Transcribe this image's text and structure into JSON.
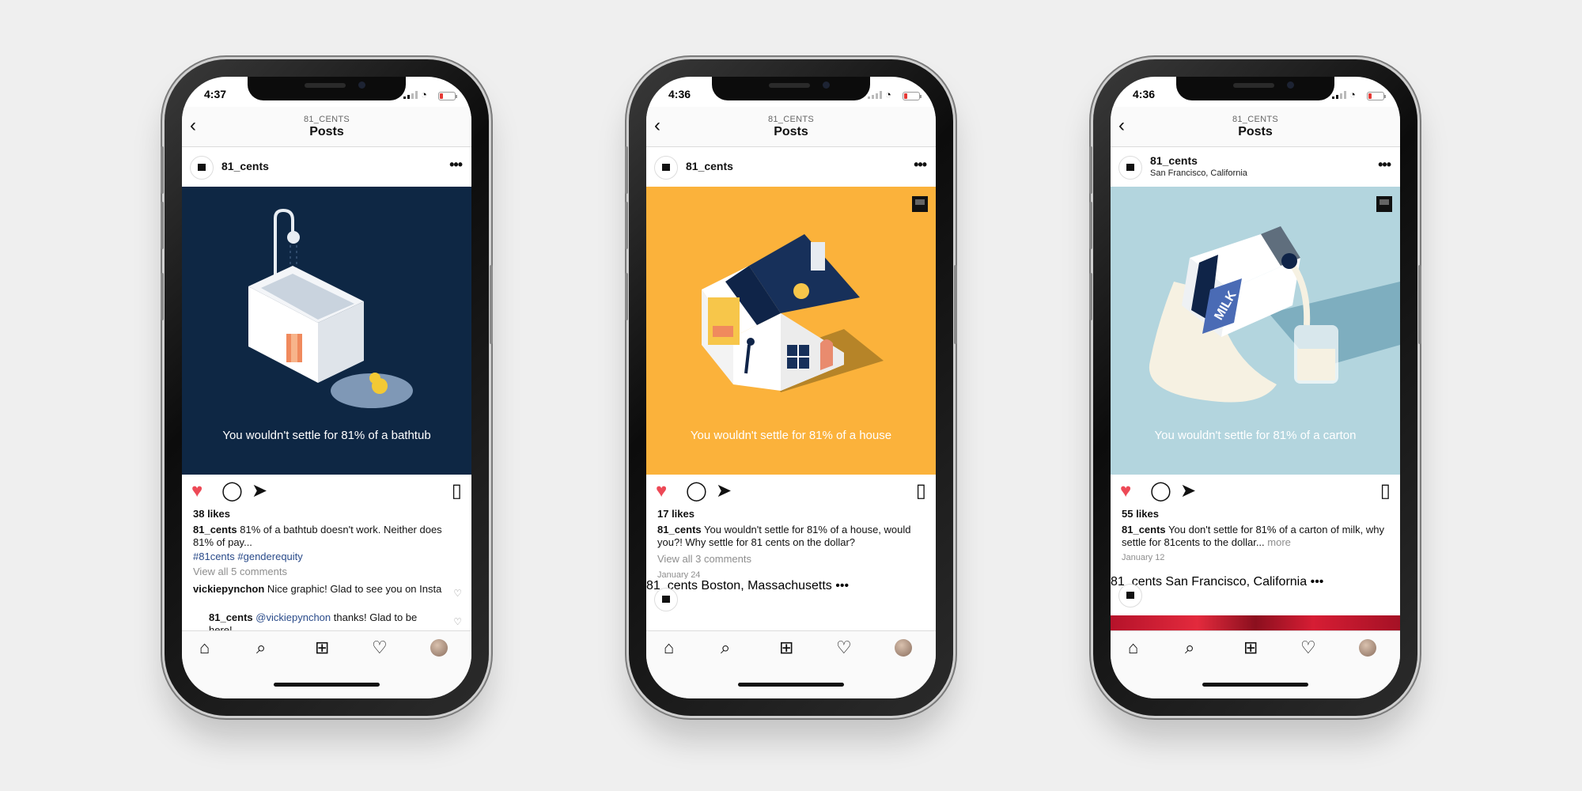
{
  "phones": [
    {
      "time": "4:37",
      "nav_username": "81_CENTS",
      "nav_title": "Posts",
      "account": "81_cents",
      "location": "",
      "image_caption": "You wouldn't settle for 81% of a bathtub",
      "image_bg": "#0e2744",
      "likes": "38 likes",
      "caption_user": "81_cents",
      "caption_text": " 81% of a bathtub doesn't work. Neither does 81% of pay...",
      "hashtags": "#81cents #genderequity",
      "view_comments": "View all 5 comments",
      "comment1_user": "vickiepynchon",
      "comment1_text": " Nice graphic! Glad to see you on Insta",
      "comment2_user": "81_cents",
      "comment2_mention": "@vickiepynchon",
      "comment2_text": " thanks! Glad to be here!"
    },
    {
      "time": "4:36",
      "nav_username": "81_CENTS",
      "nav_title": "Posts",
      "account": "81_cents",
      "location": "",
      "image_caption": "You wouldn't settle for 81% of a house",
      "image_bg": "#fbb23b",
      "likes": "17 likes",
      "caption_user": "81_cents",
      "caption_text": " You wouldn't settle for 81% of a house, would you?! Why settle for 81 cents on the dollar?",
      "view_comments": "View all 3 comments",
      "date": "January 24",
      "next_account": "81_cents",
      "next_location": "Boston, Massachusetts"
    },
    {
      "time": "4:36",
      "nav_username": "81_CENTS",
      "nav_title": "Posts",
      "account": "81_cents",
      "location": "San Francisco, California",
      "image_caption": "You wouldn't settle for 81% of a carton",
      "image_bg": "#b3d5de",
      "likes": "55 likes",
      "caption_user": "81_cents",
      "caption_text": " You don't settle for 81% of a carton of milk, why settle for 81cents to the dollar...",
      "more": "more",
      "date": "January 12",
      "next_account": "81_cents",
      "next_location": "San Francisco, California",
      "milk_label": "MILK"
    }
  ],
  "icons": {
    "back": "chevron-left-icon",
    "more": "more-dots-icon",
    "like": "heart-filled-icon",
    "comment": "comment-icon",
    "share": "paper-plane-icon",
    "save": "bookmark-icon",
    "home": "home-icon",
    "search": "search-icon",
    "add": "add-square-icon",
    "activity": "heart-outline-icon"
  },
  "colors": {
    "like_red": "#ed4956",
    "hashtag_blue": "#2a4b8a",
    "muted": "#8e8e8e"
  }
}
